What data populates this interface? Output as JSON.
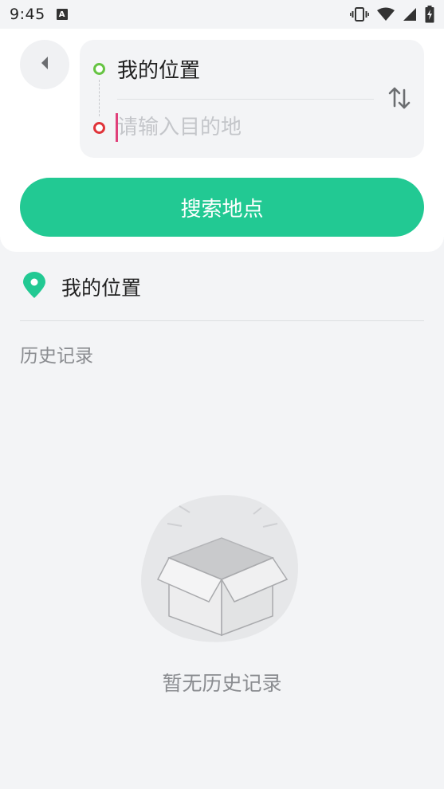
{
  "status_bar": {
    "time": "9:45",
    "notification_icon": "A"
  },
  "route": {
    "origin": "我的位置",
    "destination_placeholder": "请输入目的地",
    "origin_color": "#66c443",
    "destination_color": "#e0343a"
  },
  "search_button_label": "搜索地点",
  "accent_color": "#22c993",
  "my_location": {
    "label": "我的位置"
  },
  "history": {
    "title": "历史记录",
    "empty_text": "暂无历史记录"
  }
}
